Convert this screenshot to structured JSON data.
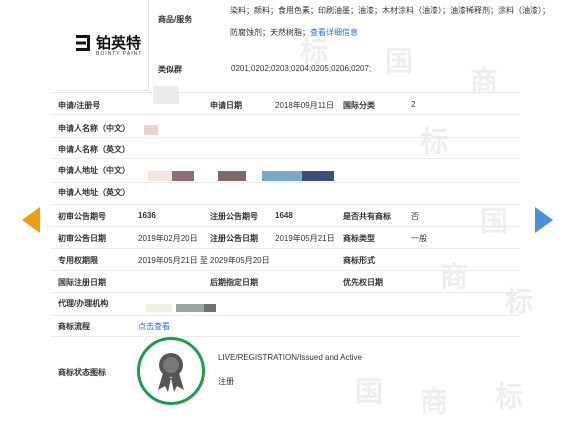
{
  "brand": {
    "name": "铂英特",
    "sub": "BOINTY PAINT"
  },
  "goods": {
    "label": "商品/服务",
    "line1": "染料；颜料；食用色素；印刷油墨；油漆；木材涂料（油漆）；油漆稀释剂；涂料（油漆）；",
    "line2_prefix": "防腐蚀剂；天然树脂；",
    "line2_link": "查看详细信息"
  },
  "similar": {
    "label": "类似群",
    "value": "0201;0202;0203;0204;0205;0206;0207;"
  },
  "fields": {
    "reg_no": "申请/注册号",
    "apply_date_label": "申请日期",
    "apply_date": "2018年09月11日",
    "intl_class_label": "国际分类",
    "intl_class": "2",
    "applicant_cn": "申请人名称（中文）",
    "applicant_en": "申请人名称（英文）",
    "address_cn": "申请人地址（中文）",
    "address_en": "申请人地址（英文）",
    "prelim_no_label": "初审公告期号",
    "prelim_no": "1636",
    "reg_no_label": "注册公告期号",
    "reg_pub_no": "1648",
    "shared_label": "是否共有商标",
    "shared": "否",
    "prelim_date_label": "初审公告日期",
    "prelim_date": "2019年02月20日",
    "reg_date_label": "注册公告日期",
    "reg_date": "2019年05月21日",
    "type_label": "商标类型",
    "type": "一般",
    "exclusive_label": "专用权期限",
    "exclusive": "2019年05月21日 至 2029年05月20日",
    "form_label": "商标形式",
    "intl_reg_label": "国际注册日期",
    "later_label": "后期指定日期",
    "priority_label": "优先权日期",
    "agent_label": "代理/办理机构",
    "flow_label": "商标流程",
    "flow_link": "点击查看",
    "status_label": "商标状态图标",
    "status_en": "LIVE/REGISTRATION/Issued and Active",
    "status_cn": "注册"
  },
  "colors": {
    "accent": "#f39c12",
    "nav_right": "#4a90d9",
    "badge": "#1f9d4c",
    "link": "#1f6fd1"
  }
}
